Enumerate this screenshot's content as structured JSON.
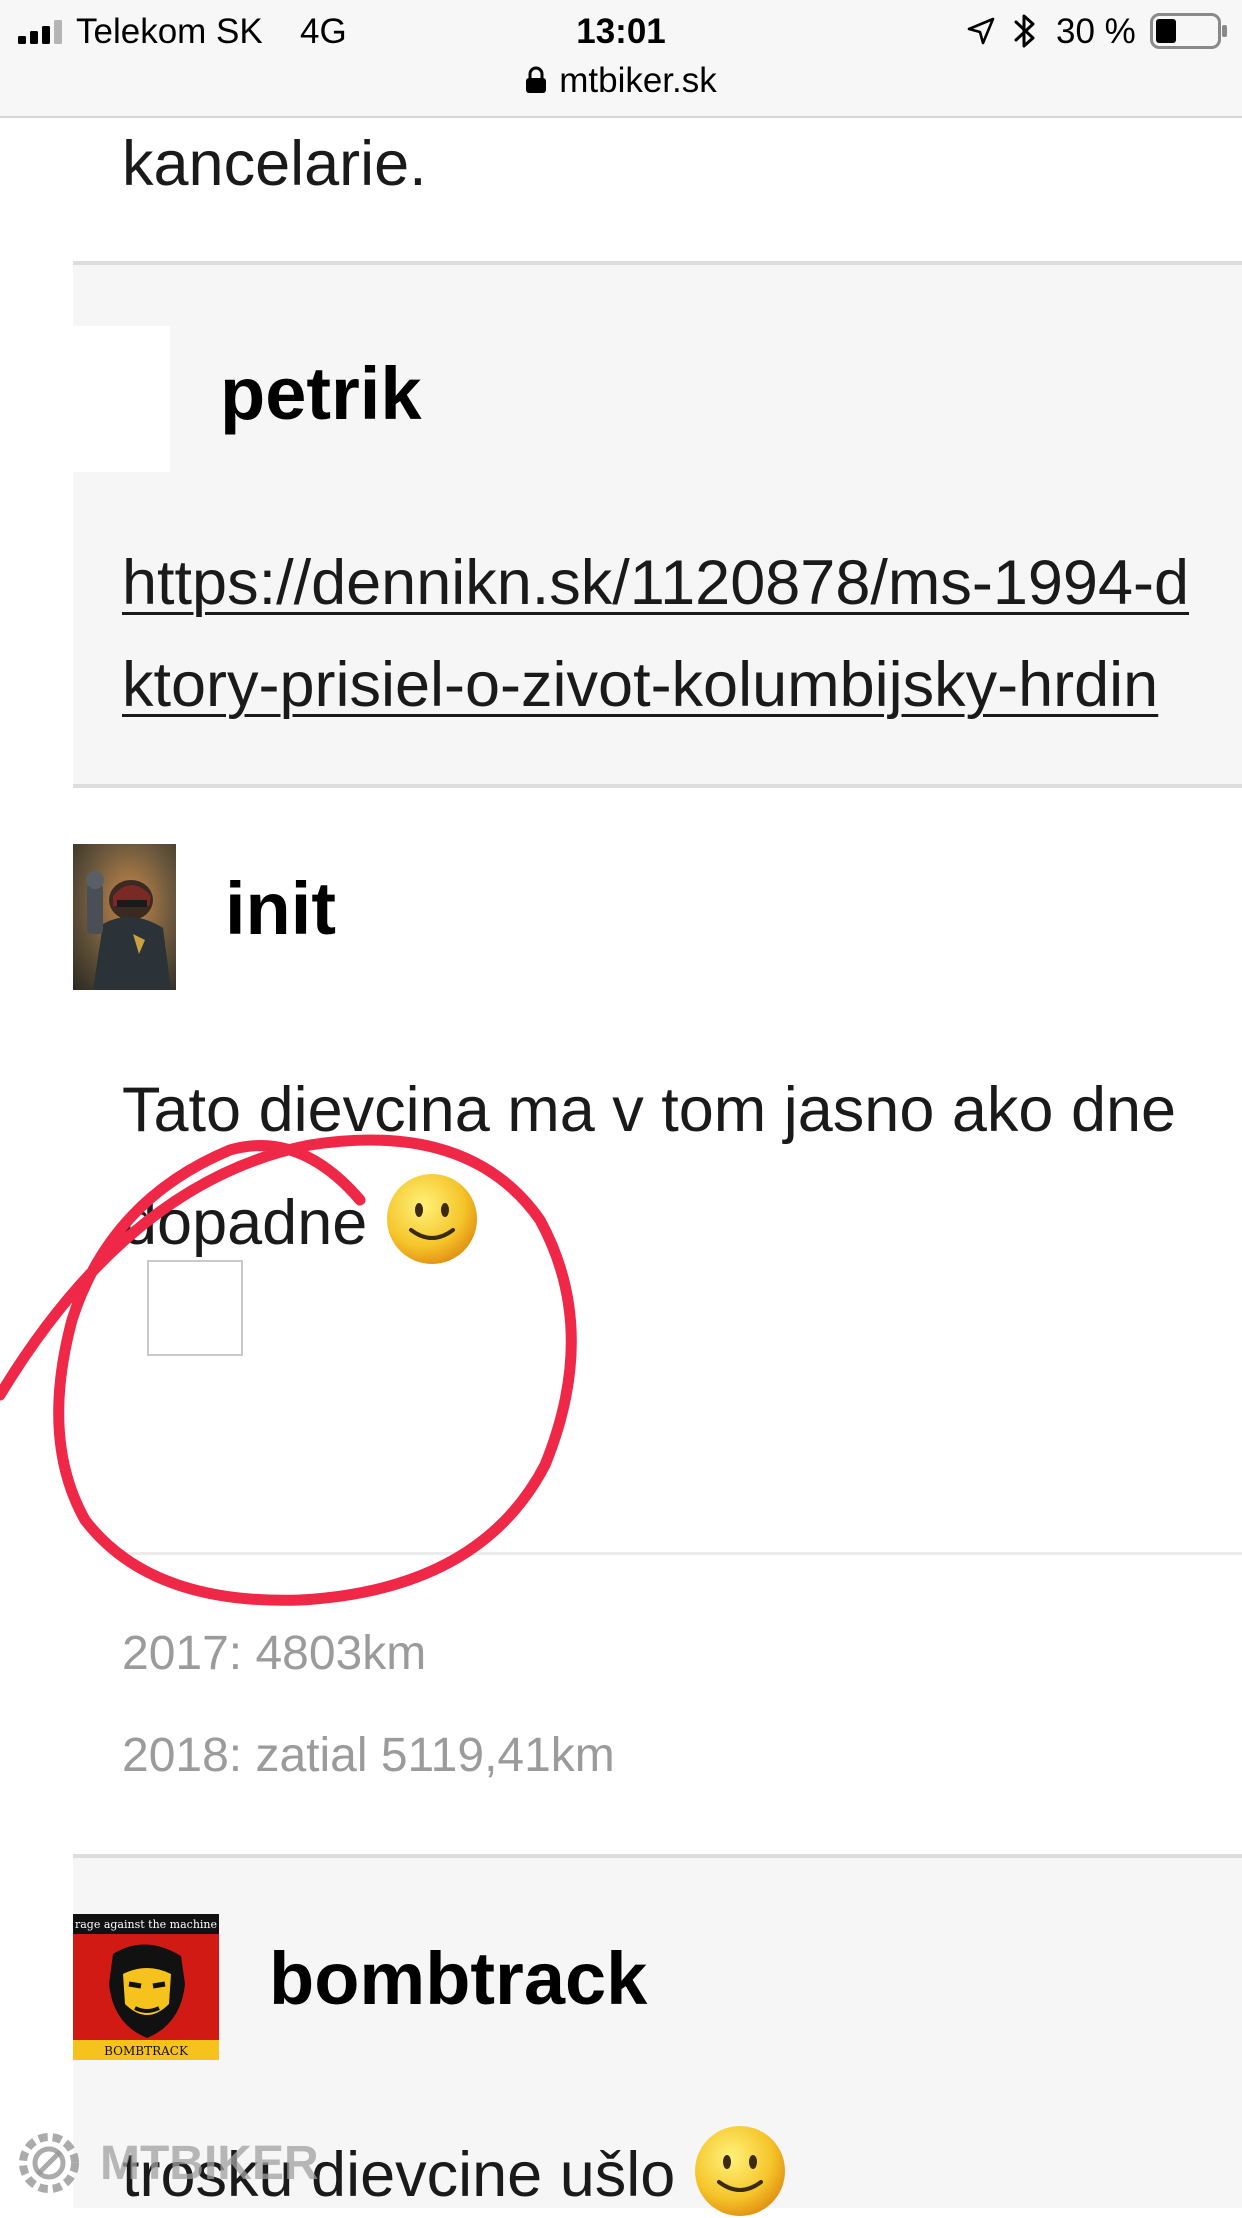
{
  "status_bar": {
    "carrier": "Telekom SK",
    "network": "4G",
    "time": "13:01",
    "battery_percent": "30 %",
    "url": "mtbiker.sk",
    "icons": [
      "signal-bars-icon",
      "location-arrow-icon",
      "bluetooth-icon",
      "battery-icon",
      "lock-icon"
    ]
  },
  "page": {
    "fragment_text": "kancelarie.",
    "posts": [
      {
        "author": "petrik",
        "avatar": "blank-avatar",
        "lines": [
          "https://dennikn.sk/1120878/ms-1994-d",
          "ktory-prisiel-o-zivot-kolumbijsky-hrdin"
        ]
      },
      {
        "author": "init",
        "avatar": "judge-dredd-avatar",
        "lines": [
          "Tato dievcina ma v tom jasno ako dne",
          "dopadne"
        ],
        "emoji": "smiley-icon",
        "signature": [
          "2017: 4803km",
          "2018: zatial 5119,41km"
        ]
      },
      {
        "author": "bombtrack",
        "avatar": "che-guevara-avatar",
        "avatar_text": "rage against the machine",
        "avatar_bottom_text": "BOMBTRACK",
        "lines": [
          "trosku dievcine ušlo"
        ],
        "emoji": "smiley-icon"
      }
    ]
  },
  "watermark": {
    "text": "MTBIKER"
  },
  "colors": {
    "status_bar_bg": "#f7f7f7",
    "post_bg": "#f6f6f6",
    "signature_text": "#9b9b9b",
    "annotation_circle": "#f02848",
    "smiley_face": "#f5c52a"
  }
}
